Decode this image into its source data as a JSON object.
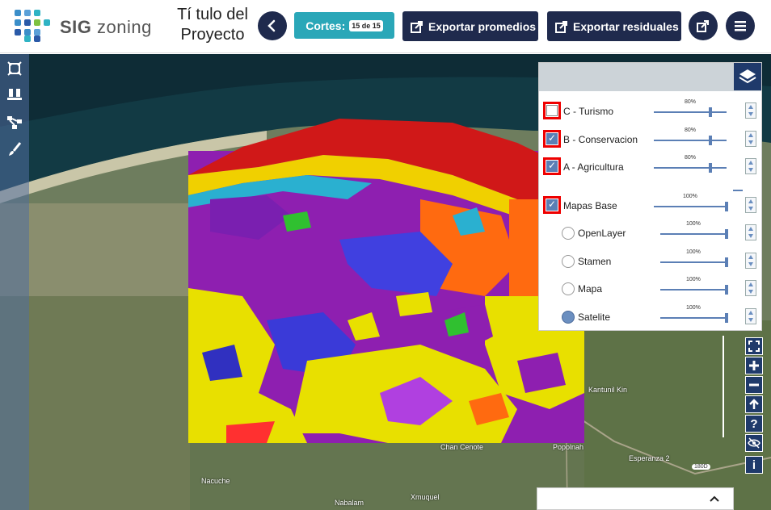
{
  "header": {
    "brand_bold": "SIG",
    "brand_light": "zoning",
    "project_title": "Tí tulo del Proyecto",
    "cortes_label": "Cortes:",
    "cortes_count": "15 de 15",
    "export_avg_label": "Exportar promedios",
    "export_res_label": "Exportar residuales"
  },
  "colors": {
    "navy": "#1f2a4d",
    "teal": "#2aa7b8",
    "panel_blue": "#1f3a6b",
    "highlight": "#e00000"
  },
  "layers": [
    {
      "label": "C - Turismo",
      "checked": false,
      "opacity": "80%"
    },
    {
      "label": "B - Conservacion",
      "checked": true,
      "opacity": "80%"
    },
    {
      "label": "A - Agricultura",
      "checked": true,
      "opacity": "80%"
    }
  ],
  "base_maps": {
    "label": "Mapas Base",
    "checked": true,
    "opacity": "100%",
    "options": [
      {
        "label": "OpenLayer",
        "selected": false,
        "opacity": "100%"
      },
      {
        "label": "Stamen",
        "selected": false,
        "opacity": "100%"
      },
      {
        "label": "Mapa",
        "selected": false,
        "opacity": "100%"
      },
      {
        "label": "Satelite",
        "selected": true,
        "opacity": "100%"
      }
    ]
  },
  "map_labels": {
    "kantunil": "Kantunil Kin",
    "chan_cenote": "Chan Cenote",
    "popolnah": "Popolnah",
    "esperanza": "Esperanza 2",
    "nacuche": "Nacuche",
    "xmuquel": "Xmuquel",
    "nabalam": "Nabalam",
    "road": "180D"
  },
  "map_controls": {
    "help": "?",
    "info": "i"
  }
}
